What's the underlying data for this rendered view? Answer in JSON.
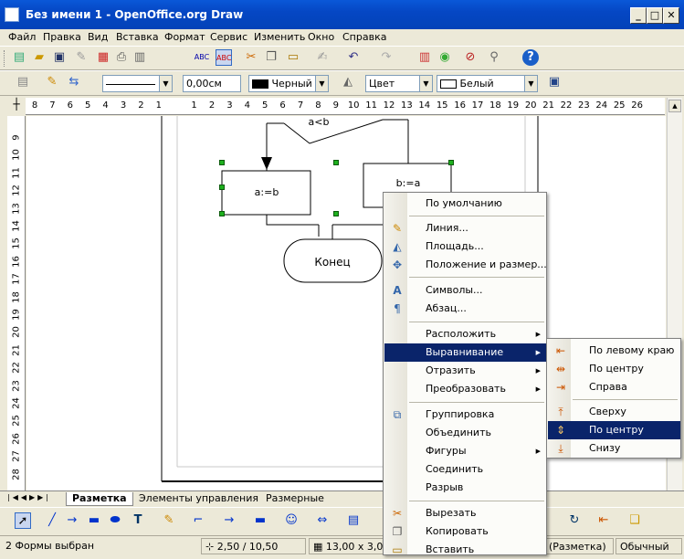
{
  "window": {
    "title": "Без имени 1 - OpenOffice.org Draw",
    "minimize": "_",
    "maximize": "□",
    "close": "✕"
  },
  "menubar": [
    "Файл",
    "Правка",
    "Вид",
    "Вставка",
    "Формат",
    "Сервис",
    "Изменить",
    "Окно",
    "Справка"
  ],
  "line_toolbar": {
    "line_style": "",
    "line_width": "0,00см",
    "line_color": "Черный",
    "area_type": "Цвет",
    "area_color": "Белый"
  },
  "ruler": {
    "h_ticks": [
      "8",
      "7",
      "6",
      "5",
      "4",
      "3",
      "2",
      "1",
      "",
      "1",
      "2",
      "3",
      "4",
      "5",
      "6",
      "7",
      "8",
      "9",
      "10",
      "11",
      "12",
      "13",
      "14",
      "15",
      "16",
      "17",
      "18",
      "19",
      "20",
      "21",
      "22",
      "23",
      "24",
      "25",
      "26"
    ],
    "v_ticks": [
      "9",
      "10",
      "11",
      "12",
      "13",
      "14",
      "15",
      "16",
      "17",
      "18",
      "19",
      "20",
      "21",
      "22",
      "23",
      "24",
      "25",
      "26",
      "27",
      "28"
    ]
  },
  "drawing": {
    "cond_label": "a<b",
    "box1_label": "a:=b",
    "box2_label": "b:=a",
    "end_label": "Конец"
  },
  "tabs": {
    "layout": "Разметка",
    "controls": "Элементы управления",
    "dimensions": "Размерные"
  },
  "status": {
    "selection": "2 Формы выбран",
    "position": "2,50 / 10,50",
    "size": "13,00 x 3,00",
    "layer": "(Разметка)",
    "mode": "Обычный"
  },
  "context_menu": {
    "items": [
      {
        "label": "По умолчанию",
        "icon": ""
      },
      {
        "label": "Линия...",
        "icon": "pen-icon"
      },
      {
        "label": "Площадь...",
        "icon": "paint-bucket-icon"
      },
      {
        "label": "Положение и размер...",
        "icon": "position-size-icon"
      },
      {
        "label": "Символы...",
        "icon": "character-icon"
      },
      {
        "label": "Абзац...",
        "icon": "paragraph-icon"
      },
      {
        "label": "Расположить",
        "icon": ""
      },
      {
        "label": "Выравнивание",
        "icon": ""
      },
      {
        "label": "Отразить",
        "icon": ""
      },
      {
        "label": "Преобразовать",
        "icon": ""
      },
      {
        "label": "Группировка",
        "icon": "group-icon"
      },
      {
        "label": "Объединить",
        "icon": ""
      },
      {
        "label": "Фигуры",
        "icon": ""
      },
      {
        "label": "Соединить",
        "icon": ""
      },
      {
        "label": "Разрыв",
        "icon": ""
      },
      {
        "label": "Вырезать",
        "icon": "scissors-icon"
      },
      {
        "label": "Копировать",
        "icon": "copy-icon"
      },
      {
        "label": "Вставить",
        "icon": "paste-icon"
      }
    ]
  },
  "align_submenu": {
    "items": [
      {
        "label": "По левому краю",
        "icon": "align-left-icon"
      },
      {
        "label": "По центру",
        "icon": "align-center-icon"
      },
      {
        "label": "Справа",
        "icon": "align-right-icon"
      },
      {
        "label": "Сверху",
        "icon": "align-top-icon"
      },
      {
        "label": "По центру",
        "icon": "align-middle-icon"
      },
      {
        "label": "Снизу",
        "icon": "align-bottom-icon"
      }
    ]
  },
  "colors": {
    "title_bar": "#0a58d8",
    "selection": "#0a246a",
    "handle": "#1eb01e"
  }
}
